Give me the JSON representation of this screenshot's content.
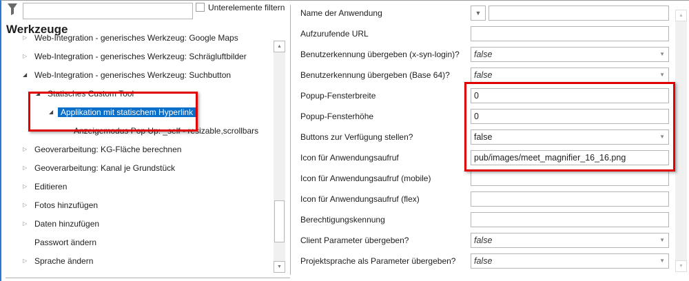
{
  "left": {
    "filter_placeholder": "",
    "subfilter_label": "Unterelemente filtern",
    "title": "Werkzeuge",
    "tree": [
      {
        "label": "Web-Integration - generisches Werkzeug: Google Maps",
        "state": "collapsed"
      },
      {
        "label": "Web-Integration - generisches Werkzeug: Schrägluftbilder",
        "state": "collapsed"
      },
      {
        "label": "Web-Integration - generisches Werkzeug: Suchbutton",
        "state": "expanded"
      },
      {
        "label": "Statisches Custom Tool",
        "state": "expanded"
      },
      {
        "label": "Applikation mit statischem Hyperlink",
        "state": "expanded",
        "selected": true
      },
      {
        "label": "Anzeigemodus Pop Up: _self - resizable,scrollbars",
        "state": "leaf"
      },
      {
        "label": "Geoverarbeitung: KG-Fläche berechnen",
        "state": "collapsed"
      },
      {
        "label": "Geoverarbeitung: Kanal je Grundstück",
        "state": "collapsed"
      },
      {
        "label": "Editieren",
        "state": "collapsed"
      },
      {
        "label": "Fotos hinzufügen",
        "state": "collapsed"
      },
      {
        "label": "Daten hinzufügen",
        "state": "collapsed"
      },
      {
        "label": "Passwort ändern",
        "state": "leaf"
      },
      {
        "label": "Sprache ändern",
        "state": "collapsed"
      }
    ]
  },
  "properties": [
    {
      "label": "Name der Anwendung",
      "value": "",
      "type": "combo"
    },
    {
      "label": "Aufzurufende URL",
      "value": "",
      "type": "text"
    },
    {
      "label": "Benutzerkennung übergeben (x-syn-login)?",
      "value": "false",
      "type": "select-default"
    },
    {
      "label": "Benutzerkennung übergeben (Base 64)?",
      "value": "false",
      "type": "select-default"
    },
    {
      "label": "Popup-Fensterbreite",
      "value": "0",
      "type": "text"
    },
    {
      "label": "Popup-Fensterhöhe",
      "value": "0",
      "type": "text"
    },
    {
      "label": "Buttons zur Verfügung stellen?",
      "value": "false",
      "type": "select"
    },
    {
      "label": "Icon für Anwendungsaufruf",
      "value": "pub/images/meet_magnifier_16_16.png",
      "type": "text"
    },
    {
      "label": "Icon für Anwendungsaufruf (mobile)",
      "value": "",
      "type": "text"
    },
    {
      "label": "Icon für Anwendungsaufruf (flex)",
      "value": "",
      "type": "text"
    },
    {
      "label": "Berechtigungskennung",
      "value": "",
      "type": "text"
    },
    {
      "label": "Client Parameter übergeben?",
      "value": "false",
      "type": "select-default"
    },
    {
      "label": "Projektsprache als Parameter übergeben?",
      "value": "false",
      "type": "select-default"
    }
  ],
  "colors": {
    "highlight": "#e00000",
    "selection": "#0a6fc9"
  }
}
